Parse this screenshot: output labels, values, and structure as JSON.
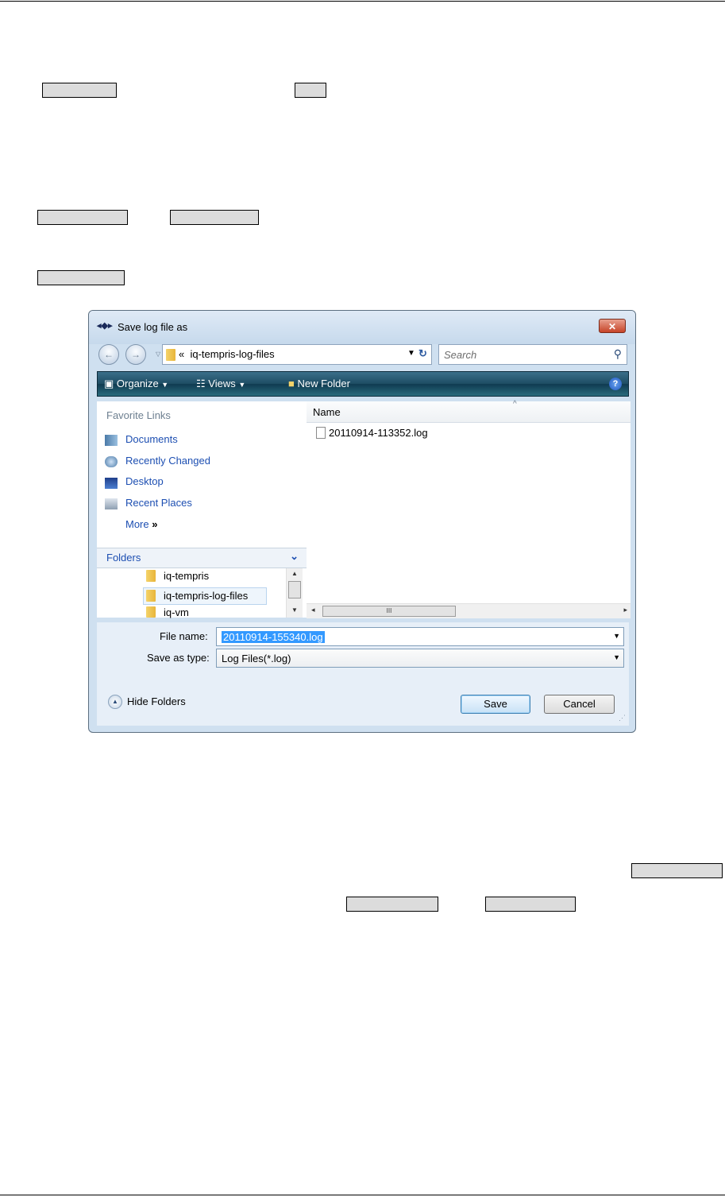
{
  "dialog": {
    "title": "Save log file as",
    "close_glyph": "✕",
    "nav": {
      "back_glyph": "←",
      "forward_glyph": "→",
      "recent_glyph": "▽",
      "address_chevron": "«",
      "address_path": "iq-tempris-log-files",
      "address_drop": "▼",
      "refresh_glyph": "↻",
      "search_placeholder": "Search",
      "search_glyph": "⚲"
    },
    "toolbar": {
      "organize": "Organize",
      "views": "Views",
      "new_folder": "New Folder",
      "drop_glyph": "▼",
      "help_glyph": "?"
    },
    "favorites": {
      "heading": "Favorite Links",
      "items": [
        "Documents",
        "Recently Changed",
        "Desktop",
        "Recent Places"
      ],
      "more": "More",
      "more_glyph": "»"
    },
    "folders": {
      "label": "Folders",
      "chevron": "⌄",
      "tree": [
        "iq-tempris",
        "iq-tempris-log-files",
        "iq-vm"
      ]
    },
    "file_list": {
      "column_name": "Name",
      "sort_glyph": "^",
      "files": [
        "20110914-113352.log"
      ],
      "scroll_thumb": "III"
    },
    "form": {
      "file_name_label": "File name:",
      "file_name_value": "20110914-155340.log",
      "save_as_type_label": "Save as type:",
      "save_as_type_value": "Log Files(*.log)",
      "drop_glyph": "▼"
    },
    "hide_folders": "Hide Folders",
    "save_button": "Save",
    "cancel_button": "Cancel",
    "grip_glyph": "⋰"
  },
  "colors": {
    "link_blue": "#1d4fb2",
    "toolbar_teal": "#1d4c63",
    "selection_blue": "#3399ff"
  }
}
